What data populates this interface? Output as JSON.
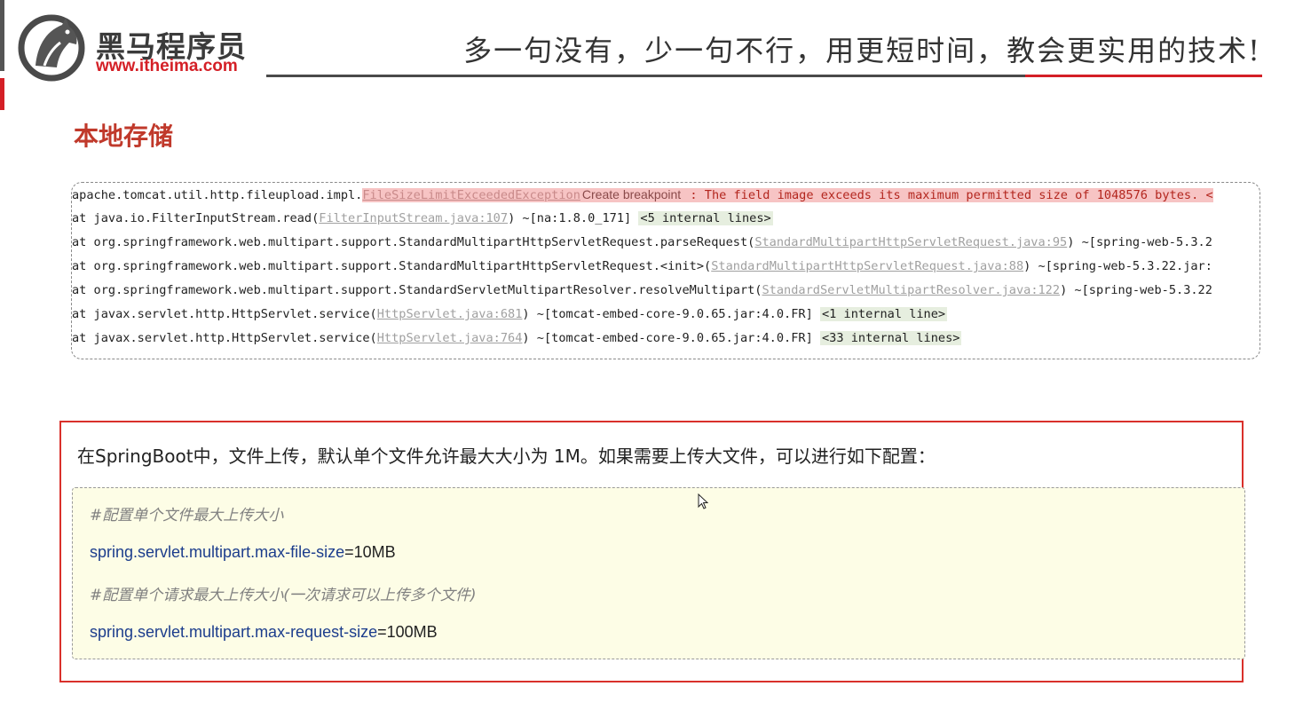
{
  "header": {
    "logo_cn": "黑马程序员",
    "logo_url": "www.itheima.com",
    "slogan": "多一句没有，少一句不行，用更短时间，教会更实用的技术!"
  },
  "page_title": "本地存储",
  "trace": {
    "l1": {
      "prefix": "apache.tomcat.util.http.fileupload.impl.",
      "exception": "FileSizeLimitExceededException",
      "breakpoint": "Create breakpoint",
      "message": " : The field image exceeds its maximum permitted size of 1048576 bytes. <"
    },
    "l2": {
      "text": "at java.io.FilterInputStream.read(",
      "link": "FilterInputStream.java:107",
      "after": ") ~[na:1.8.0_171] ",
      "internal": "<5 internal lines>"
    },
    "l3": {
      "text": "at org.springframework.web.multipart.support.StandardMultipartHttpServletRequest.parseRequest(",
      "link": "StandardMultipartHttpServletRequest.java:95",
      "after": ") ~[spring-web-5.3.2"
    },
    "l4": {
      "text": "at org.springframework.web.multipart.support.StandardMultipartHttpServletRequest.<init>(",
      "link": "StandardMultipartHttpServletRequest.java:88",
      "after": ") ~[spring-web-5.3.22.jar:"
    },
    "l5": {
      "text": "at org.springframework.web.multipart.support.StandardServletMultipartResolver.resolveMultipart(",
      "link": "StandardServletMultipartResolver.java:122",
      "after": ") ~[spring-web-5.3.22"
    },
    "l6": {
      "text": "at javax.servlet.http.HttpServlet.service(",
      "link": "HttpServlet.java:681",
      "after": ") ~[tomcat-embed-core-9.0.65.jar:4.0.FR] ",
      "internal": "<1 internal line>"
    },
    "l7": {
      "text": "at javax.servlet.http.HttpServlet.service(",
      "link": "HttpServlet.java:764",
      "after": ") ~[tomcat-embed-core-9.0.65.jar:4.0.FR] ",
      "internal": "<33 internal lines>"
    }
  },
  "note": {
    "text": "在SpringBoot中，文件上传，默认单个文件允许最大大小为 1M。如果需要上传大文件，可以进行如下配置：",
    "comment1": "#配置单个文件最大上传大小",
    "prop1_key": "spring.servlet.multipart.max-file-size",
    "prop1_val": "=10MB",
    "comment2": "#配置单个请求最大上传大小(一次请求可以上传多个文件)",
    "prop2_key": "spring.servlet.multipart.max-request-size",
    "prop2_val": "=100MB"
  },
  "colors": {
    "accent_red": "#d41f26",
    "title_red": "#c0392b",
    "config_bg": "#fdfde6",
    "key_blue": "#1c3d8c"
  },
  "icons": {
    "logo": "horse-head-logo-icon",
    "cursor": "mouse-pointer-icon"
  }
}
